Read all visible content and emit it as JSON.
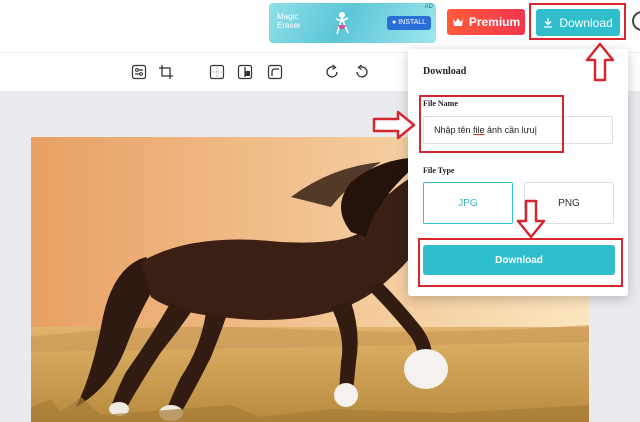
{
  "ad": {
    "brand": "Magic Eraser",
    "install_label": "INSTALL",
    "ad_tag": "AD"
  },
  "header": {
    "premium_label": "Premium",
    "download_label": "Download"
  },
  "toolbar": {
    "tools": [
      "adjust-icon",
      "crop-icon",
      "grid-icon",
      "flip-icon",
      "rounded-corner-icon",
      "rotate-right-icon",
      "rotate-left-icon"
    ]
  },
  "download_panel": {
    "title": "Download",
    "file_name_label": "File Name",
    "file_name_before": "Nhập tên ",
    "file_name_underlined": "file",
    "file_name_after": " ảnh cần lưu",
    "file_type_label": "File Type",
    "types": [
      "JPG",
      "PNG"
    ],
    "selected_type": "JPG",
    "download_button": "Download"
  },
  "colors": {
    "accent": "#2fbecb",
    "premium": "#f2364f",
    "highlight": "#d7262d",
    "canvas_bg": "#e9ebef"
  }
}
